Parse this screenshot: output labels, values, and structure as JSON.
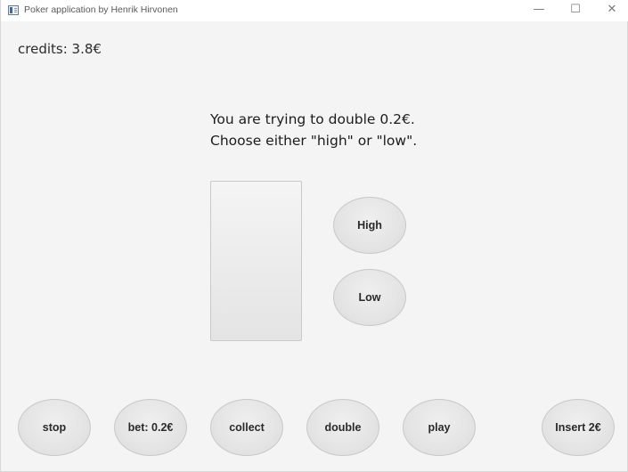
{
  "window": {
    "title": "Poker application by Henrik Hirvonen",
    "controls": {
      "minimize": "—",
      "maximize": "☐",
      "close": "✕"
    }
  },
  "credits": "credits: 3.8€",
  "message": {
    "line1": "You are trying to double 0.2€.",
    "line2": "Choose either \"high\" or \"low\"."
  },
  "card": {
    "face_visible": false
  },
  "choice_buttons": {
    "high": "High",
    "low": "Low"
  },
  "bottom_buttons": {
    "stop": "stop",
    "bet": "bet: 0.2€",
    "collect": "collect",
    "double": "double",
    "play": "play",
    "insert": "Insert 2€"
  }
}
